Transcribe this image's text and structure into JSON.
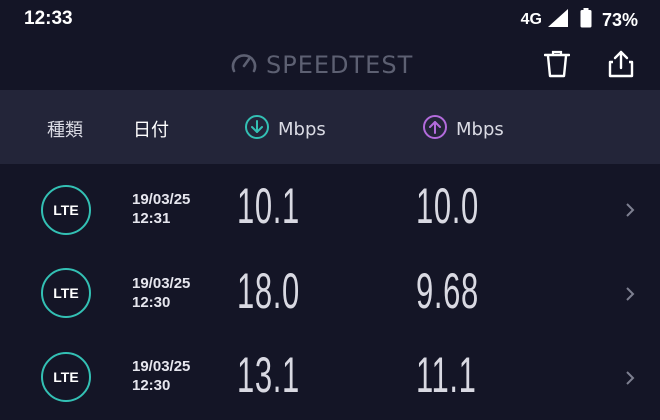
{
  "status_bar": {
    "time": "12:33",
    "network": "4G",
    "battery": "73%"
  },
  "app": {
    "brand": "SPEEDTEST"
  },
  "columns": {
    "type": "種類",
    "date": "日付",
    "download_unit": "Mbps",
    "upload_unit": "Mbps"
  },
  "results": [
    {
      "type": "LTE",
      "date": "19/03/25",
      "time": "12:31",
      "download": "10.1",
      "upload": "10.0"
    },
    {
      "type": "LTE",
      "date": "19/03/25",
      "time": "12:30",
      "download": "18.0",
      "upload": "9.68"
    },
    {
      "type": "LTE",
      "date": "19/03/25",
      "time": "12:30",
      "download": "13.1",
      "upload": "11.1"
    }
  ],
  "colors": {
    "background": "#141526",
    "header_band": "#232539",
    "download_accent": "#33c0b4",
    "upload_accent": "#b36bdc",
    "brand_gray": "#5d6072"
  }
}
